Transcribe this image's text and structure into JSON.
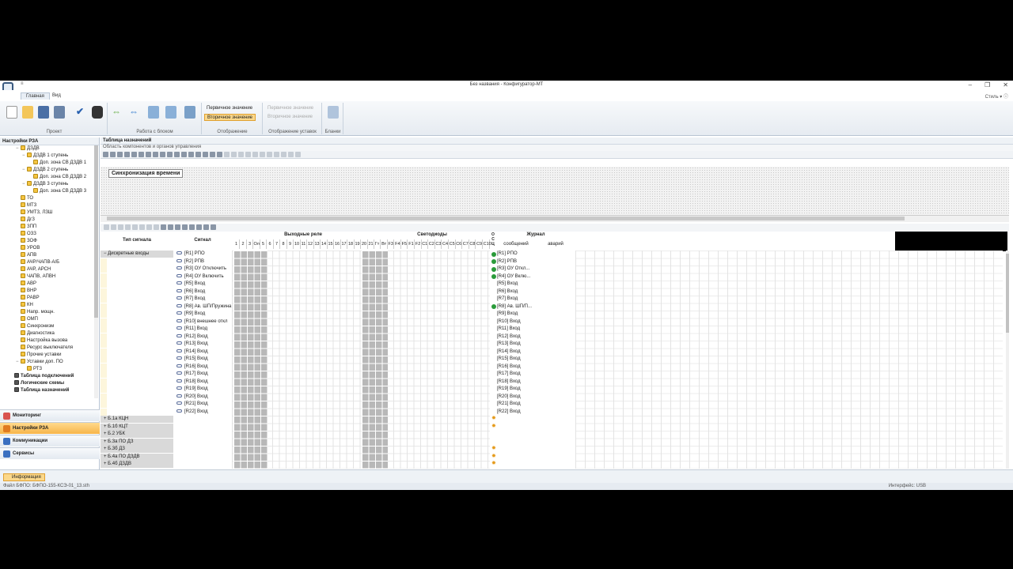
{
  "window": {
    "title": "Без названия - Конфигуратор-МТ",
    "qat": "≡",
    "style_label": "Стиль"
  },
  "tabs": [
    "Главная",
    "Вид"
  ],
  "ribbon": {
    "groups": [
      "Проект",
      "Работа с блоком",
      "Отображение",
      "Отображение уставок",
      "Бланки"
    ],
    "display_options": [
      "Первичное значение",
      "Вторичное значение"
    ],
    "setpoint_options": [
      "Первичное значение",
      "Вторичное значение"
    ]
  },
  "left_panel": {
    "header": "Настройки РЗА",
    "tree": [
      {
        "label": "ДЗДВ",
        "indent": 2,
        "pm": "−",
        "cb": true
      },
      {
        "label": "ДЗДВ 1 ступень",
        "indent": 3,
        "pm": "−",
        "cb": true
      },
      {
        "label": "Доп. зона СВ ДЗДВ 1",
        "indent": 4,
        "pm": "",
        "cb": true
      },
      {
        "label": "ДЗДВ 2 ступень",
        "indent": 3,
        "pm": "−",
        "cb": true
      },
      {
        "label": "Доп. зона СВ ДЗДВ 2",
        "indent": 4,
        "pm": "",
        "cb": true
      },
      {
        "label": "ДЗДВ 3 ступень",
        "indent": 3,
        "pm": "−",
        "cb": true
      },
      {
        "label": "Доп. зона СВ ДЗДВ 3",
        "indent": 4,
        "pm": "",
        "cb": true
      },
      {
        "label": "ТО",
        "indent": 2,
        "pm": "",
        "cb": true
      },
      {
        "label": "МТЗ",
        "indent": 2,
        "pm": "",
        "cb": true
      },
      {
        "label": "УМТЗ, ЛЗШ",
        "indent": 2,
        "pm": "",
        "cb": true
      },
      {
        "label": "ДгЗ",
        "indent": 2,
        "pm": "",
        "cb": true
      },
      {
        "label": "ЗПП",
        "indent": 2,
        "pm": "",
        "cb": true
      },
      {
        "label": "ОЗЗ",
        "indent": 2,
        "pm": "",
        "cb": true
      },
      {
        "label": "ЗОФ",
        "indent": 2,
        "pm": "",
        "cb": true
      },
      {
        "label": "УРОВ",
        "indent": 2,
        "pm": "",
        "cb": true
      },
      {
        "label": "АПВ",
        "indent": 2,
        "pm": "",
        "cb": true
      },
      {
        "label": "АЧР/ЧАПВ-А/Б",
        "indent": 2,
        "pm": "",
        "cb": true
      },
      {
        "label": "АЧР, АРСН",
        "indent": 2,
        "pm": "",
        "cb": true
      },
      {
        "label": "ЧАПВ, АПВН",
        "indent": 2,
        "pm": "",
        "cb": true
      },
      {
        "label": "АВР",
        "indent": 2,
        "pm": "",
        "cb": true
      },
      {
        "label": "ВНР",
        "indent": 2,
        "pm": "",
        "cb": true
      },
      {
        "label": "РАВР",
        "indent": 2,
        "pm": "",
        "cb": true
      },
      {
        "label": "КН",
        "indent": 2,
        "pm": "",
        "cb": true
      },
      {
        "label": "Напр. мощн.",
        "indent": 2,
        "pm": "",
        "cb": true
      },
      {
        "label": "ОМП",
        "indent": 2,
        "pm": "",
        "cb": true
      },
      {
        "label": "Синхронизм",
        "indent": 2,
        "pm": "",
        "cb": true
      },
      {
        "label": "Диагностика",
        "indent": 2,
        "pm": "",
        "cb": true
      },
      {
        "label": "Настройка вызова",
        "indent": 2,
        "pm": "",
        "cb": true
      },
      {
        "label": "Ресурс выключателя",
        "indent": 2,
        "pm": "",
        "cb": true
      },
      {
        "label": "Прочие уставки",
        "indent": 2,
        "pm": "",
        "cb": true
      },
      {
        "label": "Уставки доп. ПО",
        "indent": 2,
        "pm": "−",
        "cb": true
      },
      {
        "label": "РТЗ",
        "indent": 3,
        "pm": "",
        "cb": true
      },
      {
        "label": "Таблица подключений",
        "indent": 1,
        "pm": "",
        "cb": false,
        "bold": true
      },
      {
        "label": "Логические схемы",
        "indent": 1,
        "pm": "",
        "cb": false,
        "bold": true
      },
      {
        "label": "Таблица назначений",
        "indent": 1,
        "pm": "",
        "cb": false,
        "bold": true,
        "hl": true
      }
    ],
    "nav": [
      "Мониторинг",
      "Настройки РЗА",
      "Коммуникации",
      "Сервисы"
    ],
    "nav_active": 1
  },
  "main": {
    "title": "Таблица назначений",
    "subtitle": "Область компонентов и органов управления",
    "sync_label": "Синхронизация времени",
    "grid_headers": {
      "type": "Тип сигнала",
      "signal": "Сигнал",
      "relays": "Выходные реле",
      "leds": "Светодиоды",
      "osc": "О С Ц",
      "journal": "Журнал",
      "journal_sub": [
        "сообщений",
        "аварий"
      ]
    },
    "relay_cols": [
      "1",
      "2",
      "3",
      "Ол",
      "5",
      "6",
      "7",
      "8",
      "9",
      "10",
      "11",
      "12",
      "13",
      "14",
      "15",
      "16",
      "17",
      "18",
      "19",
      "20",
      "21"
    ],
    "led_cols": [
      "Гт",
      "Вт",
      "F3",
      "F4",
      "F5",
      "F1",
      "F2",
      "C1",
      "C2",
      "C3",
      "C4",
      "C5",
      "C6",
      "C7",
      "C8",
      "C9",
      "C10"
    ],
    "group_label": "Дискретные входы",
    "signals": [
      {
        "sig": "[R1] РПО",
        "osc": "led",
        "msg": "[R1] РПО"
      },
      {
        "sig": "[R2] РПВ",
        "osc": "led",
        "msg": "[R2] РПВ"
      },
      {
        "sig": "[R3] ОУ Отключить",
        "osc": "led",
        "msg": "[R3] ОУ Откл..."
      },
      {
        "sig": "[R4] ОУ Включить",
        "osc": "led",
        "msg": "[R4] ОУ Вклю..."
      },
      {
        "sig": "[R5] Вход",
        "osc": "",
        "msg": "[R5] Вход"
      },
      {
        "sig": "[R6] Вход",
        "osc": "",
        "msg": "[R6] Вход"
      },
      {
        "sig": "[R7] Вход",
        "osc": "",
        "msg": "[R7] Вход"
      },
      {
        "sig": "[R8] Ав. ШП/Пружина",
        "osc": "led",
        "msg": "[R8] Ав. ШП/П..."
      },
      {
        "sig": "[R9] Вход",
        "osc": "",
        "msg": "[R9] Вход"
      },
      {
        "sig": "[R10] внешнее откл",
        "osc": "",
        "msg": "[R10] Вход"
      },
      {
        "sig": "[R11] Вход",
        "osc": "",
        "msg": "[R11] Вход"
      },
      {
        "sig": "[R12] Вход",
        "osc": "",
        "msg": "[R12] Вход"
      },
      {
        "sig": "[R13] Вход",
        "osc": "",
        "msg": "[R13] Вход"
      },
      {
        "sig": "[R14] Вход",
        "osc": "",
        "msg": "[R14] Вход"
      },
      {
        "sig": "[R15] Вход",
        "osc": "",
        "msg": "[R15] Вход"
      },
      {
        "sig": "[R16] Вход",
        "osc": "",
        "msg": "[R16] Вход"
      },
      {
        "sig": "[R17] Вход",
        "osc": "",
        "msg": "[R17] Вход"
      },
      {
        "sig": "[R18] Вход",
        "osc": "",
        "msg": "[R18] Вход"
      },
      {
        "sig": "[R19] Вход",
        "osc": "",
        "msg": "[R19] Вход"
      },
      {
        "sig": "[R20] Вход",
        "osc": "",
        "msg": "[R20] Вход"
      },
      {
        "sig": "[R21] Вход",
        "osc": "",
        "msg": "[R21] Вход"
      },
      {
        "sig": "[R22] Вход",
        "osc": "",
        "msg": "[R22] Вход"
      }
    ],
    "groups": [
      {
        "label": "Б.1а КЦН",
        "osc": "star"
      },
      {
        "label": "Б.1б КЦТ",
        "osc": "star"
      },
      {
        "label": "Б.2 УБК",
        "osc": ""
      },
      {
        "label": "Б.3а ПО ДЗ",
        "osc": ""
      },
      {
        "label": "Б.3б ДЗ",
        "osc": "star"
      },
      {
        "label": "Б.4а ПО ДЗДВ",
        "osc": "star"
      },
      {
        "label": "Б.4б ДЗДВ",
        "osc": "star"
      }
    ]
  },
  "status": {
    "info_tab": "Информация",
    "file": "Файл БФПО: БФПО-155-КСЭ-01_13.sth",
    "interface": "Интерфейс: USB"
  }
}
